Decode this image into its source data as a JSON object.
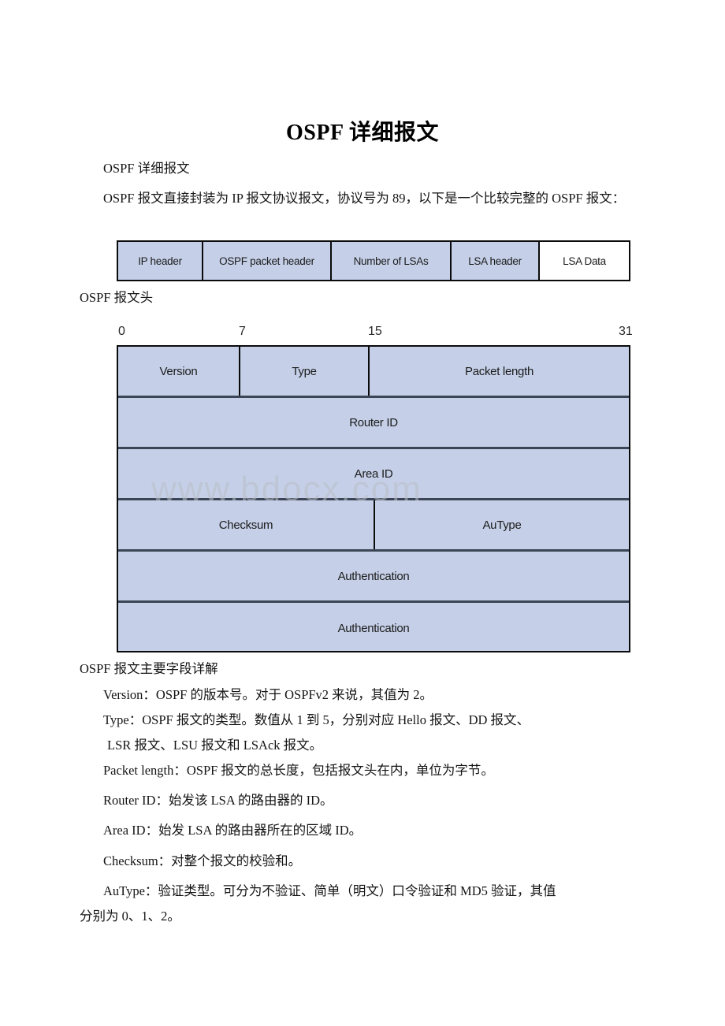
{
  "document": {
    "title": "OSPF 详细报文",
    "subtitle": "OSPF 详细报文",
    "intro": "OSPF 报文直接封装为 IP 报文协议报文，协议号为 89，以下是一个比较完整的 OSPF 报文：",
    "caption_header": "OSPF 报文头",
    "caption_fields": "OSPF 报文主要字段详解",
    "watermark": "www.bdocx.com"
  },
  "encapsulation_diagram": {
    "cells": [
      {
        "label": "IP header",
        "fill": "#c5d0e8"
      },
      {
        "label": "OSPF packet header",
        "fill": "#c5d0e8"
      },
      {
        "label": "Number of LSAs",
        "fill": "#c5d0e8"
      },
      {
        "label": "LSA header",
        "fill": "#c5d0e8"
      },
      {
        "label": "LSA Data",
        "fill": "#ffffff"
      }
    ]
  },
  "header_diagram": {
    "bit_ruler": [
      "0",
      "7",
      "15",
      "31"
    ],
    "fill_color": "#c5d0e8",
    "border_color": "#0b0b0b",
    "rows": [
      {
        "cells": [
          "Version",
          "Type",
          "Packet length"
        ]
      },
      {
        "cells": [
          "Router ID"
        ]
      },
      {
        "cells": [
          "Area ID"
        ]
      },
      {
        "cells": [
          "Checksum",
          "AuType"
        ]
      },
      {
        "cells": [
          "Authentication"
        ]
      },
      {
        "cells": [
          "Authentication"
        ]
      }
    ]
  },
  "field_descriptions": [
    {
      "name": "Version",
      "text": "Version：OSPF 的版本号。对于 OSPFv2 来说，其值为 2。"
    },
    {
      "name": "Type",
      "text": "Type：OSPF 报文的类型。数值从 1 到 5，分别对应 Hello 报文、DD 报文、"
    },
    {
      "name": "Type-cont",
      "text": "LSR 报文、LSU 报文和 LSAck 报文。"
    },
    {
      "name": "Packet length",
      "text": "Packet length：OSPF 报文的总长度，包括报文头在内，单位为字节。"
    },
    {
      "name": "Router ID",
      "text": "Router ID：始发该 LSA 的路由器的 ID。"
    },
    {
      "name": "Area ID",
      "text": "Area ID：始发 LSA 的路由器所在的区域 ID。"
    },
    {
      "name": "Checksum",
      "text": "Checksum：对整个报文的校验和。"
    },
    {
      "name": "AuType",
      "text": "AuType：验证类型。可分为不验证、简单（明文）口令验证和 MD5 验证，其值"
    },
    {
      "name": "AuType-cont",
      "text": "分别为 0、1、2。"
    }
  ]
}
